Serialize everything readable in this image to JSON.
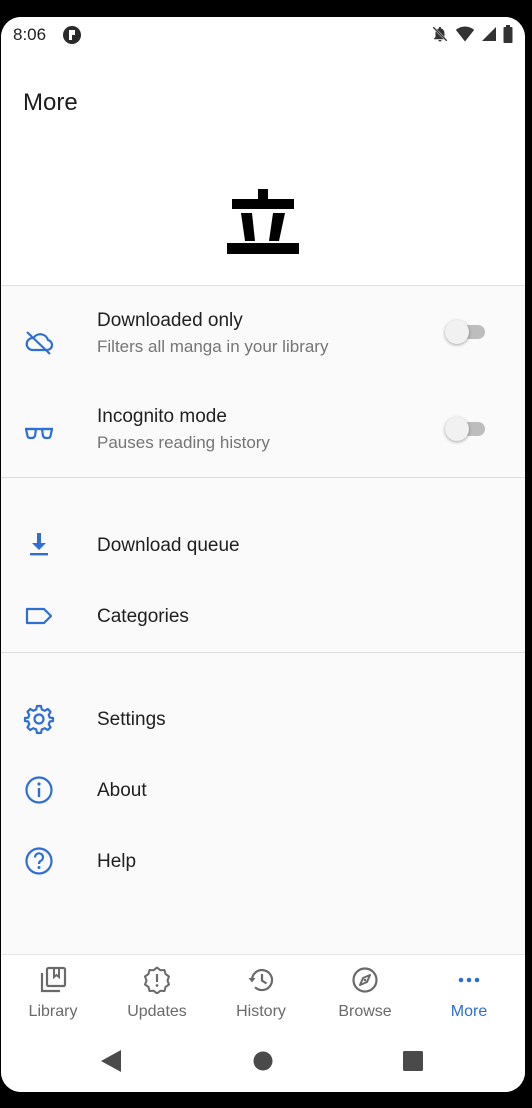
{
  "status_bar": {
    "time": "8:06"
  },
  "header": {
    "title": "More"
  },
  "toggles": [
    {
      "title": "Downloaded only",
      "subtitle": "Filters all manga in your library",
      "icon": "cloud-off-icon",
      "on": false
    },
    {
      "title": "Incognito mode",
      "subtitle": "Pauses reading history",
      "icon": "glasses-icon",
      "on": false
    }
  ],
  "menu": {
    "download_queue": "Download queue",
    "categories": "Categories",
    "settings": "Settings",
    "about": "About",
    "help": "Help"
  },
  "bottom_nav": [
    {
      "label": "Library",
      "icon": "library-icon"
    },
    {
      "label": "Updates",
      "icon": "updates-icon"
    },
    {
      "label": "History",
      "icon": "history-icon"
    },
    {
      "label": "Browse",
      "icon": "compass-icon"
    },
    {
      "label": "More",
      "icon": "more-icon",
      "active": true
    }
  ],
  "colors": {
    "accent": "#2d6fd2",
    "text": "#1f1f1f",
    "secondary_text": "#757575"
  }
}
